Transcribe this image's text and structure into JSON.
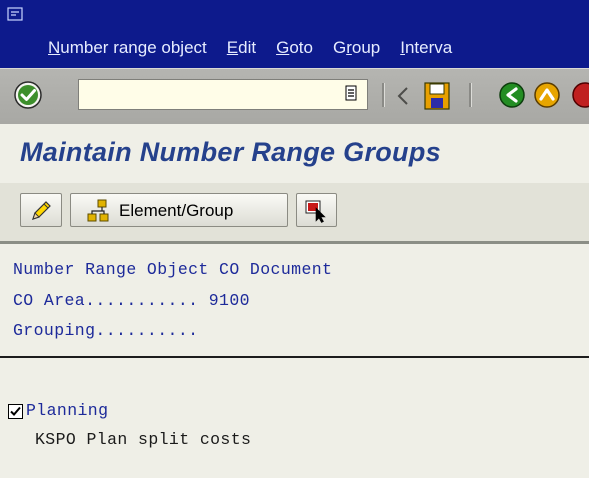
{
  "menubar": {
    "items": [
      {
        "label": "Number range object",
        "hotkey": "N"
      },
      {
        "label": "Edit",
        "hotkey": "E"
      },
      {
        "label": "Goto",
        "hotkey": "G"
      },
      {
        "label": "Group",
        "hotkey": "r"
      },
      {
        "label": "Interva",
        "hotkey": "I"
      }
    ]
  },
  "toolbar": {
    "command_field_value": "",
    "icons": [
      "enter-check-icon",
      "dropdown-history-icon",
      "back-arrow-left-icon",
      "save-icon",
      "back-icon",
      "exit-icon"
    ]
  },
  "page": {
    "title": "Maintain Number Range Groups"
  },
  "app_toolbar": {
    "element_group_label": "Element/Group",
    "icons": [
      "pencil-edit-icon",
      "element-group-icon",
      "select-cursor-icon"
    ]
  },
  "content": {
    "object_line": "Number Range Object CO Document",
    "co_area_line": "CO Area........... 9100",
    "grouping_line": "Grouping..........",
    "group": {
      "name": "Planning",
      "checked": true,
      "element_line": "KSPO Plan split costs"
    }
  },
  "colors": {
    "menubar_bg": "#0d1a8c",
    "title_color": "#25418c",
    "content_text_blue": "#1d2a9a",
    "background": "#efefe7"
  }
}
